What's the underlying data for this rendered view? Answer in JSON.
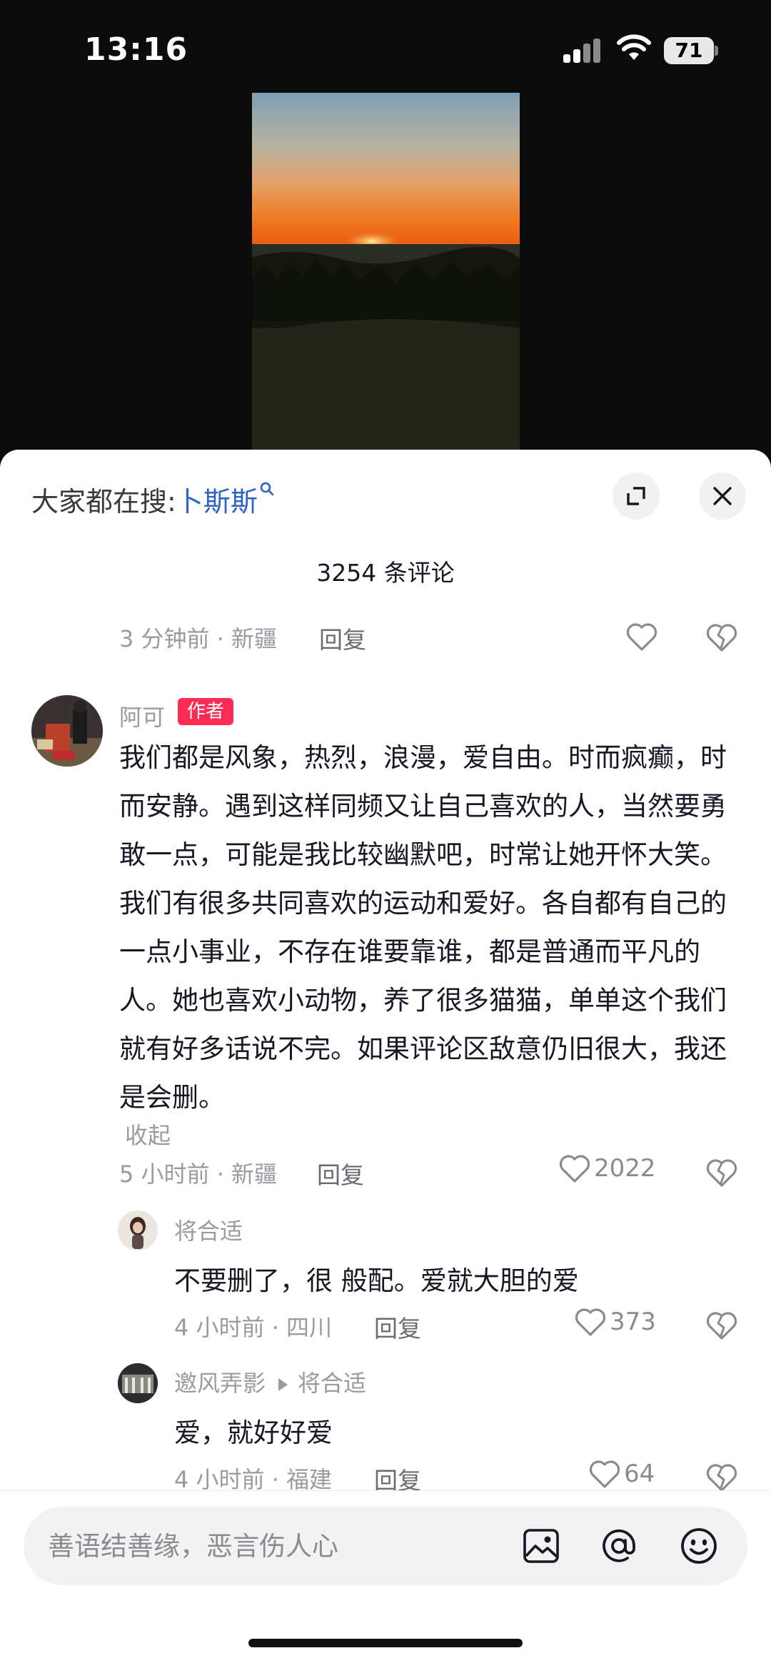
{
  "status_bar": {
    "time": "13:16",
    "battery": "71"
  },
  "sheet": {
    "search_hint_prefix": "大家都在搜:",
    "search_hint_keyword": "卜斯斯",
    "comment_count": "3254 条评论"
  },
  "prev_comment": {
    "meta": "3 分钟前 · 新疆",
    "reply": "回复"
  },
  "main_comment": {
    "author": "阿可",
    "badge": "作者",
    "text": "我们都是风象，热烈，浪漫，爱自由。时而疯癫，时而安静。遇到这样同频又让自己喜欢的人，当然要勇敢一点，可能是我比较幽默吧，时常让她开怀大笑。我们有很多共同喜欢的运动和爱好。各自都有自己的一点小事业，不存在谁要靠谁，都是普通而平凡的人。她也喜欢小动物，养了很多猫猫，单单这个我们就有好多话说不完。如果评论区敌意仍旧很大，我还是会删。",
    "collapse": "收起",
    "meta": "5 小时前 · 新疆",
    "reply": "回复",
    "likes": "2022"
  },
  "replies": [
    {
      "author": "将合适",
      "text": "不要删了，很 般配。爱就大胆的爱",
      "meta": "4 小时前 · 四川",
      "reply": "回复",
      "likes": "373"
    },
    {
      "author": "邀风弄影",
      "reply_to": "将合适",
      "text": "爱，就好好爱",
      "meta": "4 小时前 · 福建",
      "reply": "回复",
      "likes": "64"
    }
  ],
  "input": {
    "placeholder": "善语结善缘，恶言伤人心"
  },
  "icons": [
    "expand-icon",
    "close-icon",
    "heart-icon",
    "heart-break-icon",
    "image-icon",
    "at-icon",
    "emoji-icon",
    "search-icon"
  ],
  "colors": {
    "author_badge": "#fe2c55",
    "search_keyword": "#2c63c5"
  }
}
